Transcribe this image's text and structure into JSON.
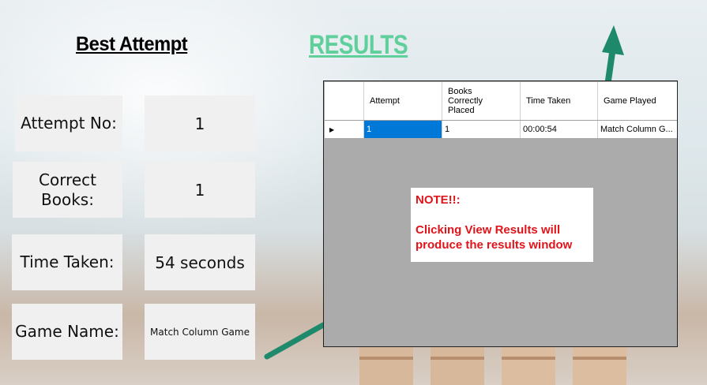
{
  "headings": {
    "best_attempt": "Best Attempt",
    "results": "RESULTS"
  },
  "best_attempt": {
    "attempt_no_label": "Attempt No:",
    "attempt_no_value": "1",
    "correct_books_label": "Correct Books:",
    "correct_books_value": "1",
    "time_taken_label": "Time Taken:",
    "time_taken_value": "54 seconds",
    "game_name_label": "Game Name:",
    "game_name_value": "Match Column Game"
  },
  "results_grid": {
    "columns": [
      "Attempt",
      "Books Correctly Placed",
      "Time Taken",
      "Game Played"
    ],
    "rows": [
      {
        "attempt": "1",
        "books": "1",
        "time": "00:00:54",
        "game": "Match Column G..."
      }
    ],
    "row_indicator": "▶"
  },
  "note": {
    "title": "NOTE!!:",
    "message": "Clicking View Results will produce the results window"
  },
  "colors": {
    "results_heading": "#5fcf9b",
    "note_text": "#e0141a",
    "selected_cell": "#0078d7",
    "panel_gray": "#ababab"
  }
}
